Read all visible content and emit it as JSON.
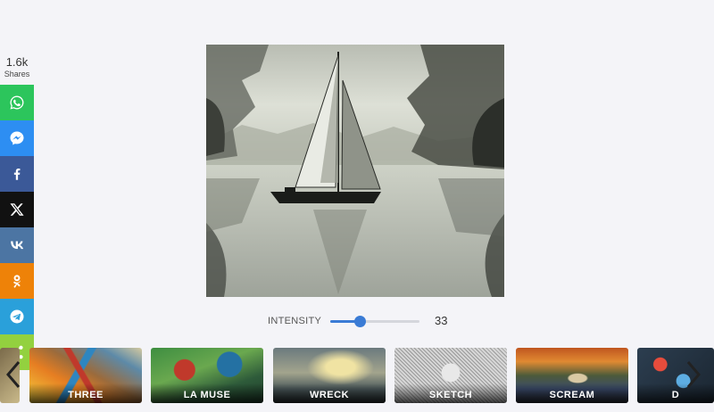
{
  "share": {
    "count": "1.6k",
    "label": "Shares",
    "buttons": [
      {
        "name": "whatsapp",
        "icon": "whatsapp-icon",
        "color": "#2cc55c"
      },
      {
        "name": "messenger",
        "icon": "messenger-icon",
        "color": "#2d8ef2"
      },
      {
        "name": "facebook",
        "icon": "facebook-icon",
        "color": "#3b5998"
      },
      {
        "name": "x",
        "icon": "x-icon",
        "color": "#111111"
      },
      {
        "name": "vk",
        "icon": "vk-icon",
        "color": "#4c75a3"
      },
      {
        "name": "odnoklassniki",
        "icon": "odnoklassniki-icon",
        "color": "#ee8208"
      },
      {
        "name": "telegram",
        "icon": "telegram-icon",
        "color": "#2aa0da"
      },
      {
        "name": "share",
        "icon": "share-icon",
        "color": "#93d13f"
      }
    ]
  },
  "intensity": {
    "label": "INTENSITY",
    "value": "33",
    "fraction": 0.33,
    "accent": "#3a7bd5"
  },
  "styles": [
    {
      "label": "THREE"
    },
    {
      "label": "LA MUSE"
    },
    {
      "label": "WRECK"
    },
    {
      "label": "SKETCH"
    },
    {
      "label": "SCREAM"
    },
    {
      "label": "D"
    }
  ]
}
